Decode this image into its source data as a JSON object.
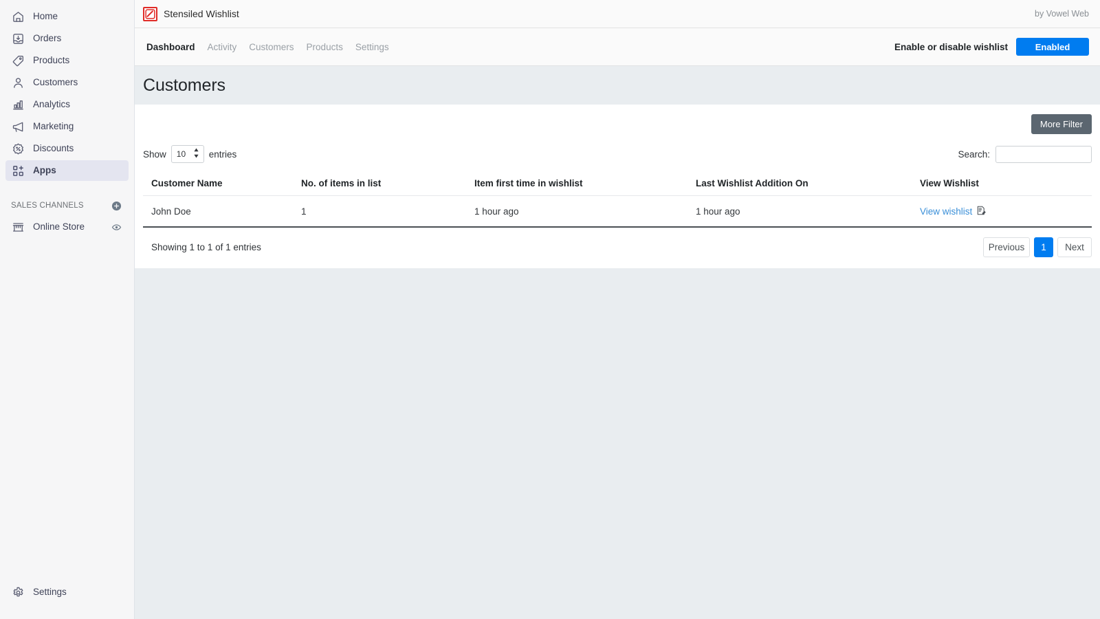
{
  "sidebar": {
    "items": [
      {
        "label": "Home",
        "icon": "home-icon",
        "active": false
      },
      {
        "label": "Orders",
        "icon": "orders-icon",
        "active": false
      },
      {
        "label": "Products",
        "icon": "products-tag-icon",
        "active": false
      },
      {
        "label": "Customers",
        "icon": "customers-person-icon",
        "active": false
      },
      {
        "label": "Analytics",
        "icon": "analytics-bars-icon",
        "active": false
      },
      {
        "label": "Marketing",
        "icon": "marketing-megaphone-icon",
        "active": false
      },
      {
        "label": "Discounts",
        "icon": "discounts-percent-icon",
        "active": false
      },
      {
        "label": "Apps",
        "icon": "apps-grid-plus-icon",
        "active": true
      }
    ],
    "section_title": "SALES CHANNELS",
    "add_channel_icon": "plus-circle-icon",
    "channels": [
      {
        "label": "Online Store",
        "icon": "storefront-icon",
        "trailing_icon": "eye-icon"
      }
    ],
    "settings": {
      "label": "Settings",
      "icon": "gear-icon"
    }
  },
  "appbar": {
    "logo_icon": "stensiled-logo-icon",
    "logo_color": "#e02b27",
    "title": "Stensiled Wishlist",
    "byline": "by Vowel Web"
  },
  "tabbar": {
    "tabs": [
      {
        "label": "Dashboard",
        "active": true
      },
      {
        "label": "Activity",
        "active": false
      },
      {
        "label": "Customers",
        "active": false
      },
      {
        "label": "Products",
        "active": false
      },
      {
        "label": "Settings",
        "active": false
      }
    ],
    "toggle_label": "Enable or disable wishlist",
    "toggle_button": "Enabled",
    "toggle_color": "#007cf0"
  },
  "page": {
    "title": "Customers"
  },
  "toolbar": {
    "more_filter": "More Filter"
  },
  "controls": {
    "show_prefix": "Show",
    "show_value": "10",
    "show_suffix": "entries",
    "search_label": "Search:",
    "search_value": "",
    "search_placeholder": ""
  },
  "table": {
    "columns": [
      "Customer Name",
      "No. of items in list",
      "Item first time in wishlist",
      "Last Wishlist Addition On",
      "View Wishlist"
    ],
    "rows": [
      {
        "customer_name": "John Doe",
        "items_count": "1",
        "first_time": "1 hour ago",
        "last_addition": "1 hour ago",
        "view_link": "View wishlist",
        "view_icon": "document-edit-icon"
      }
    ]
  },
  "footer": {
    "showing": "Showing 1 to 1 of 1 entries",
    "previous": "Previous",
    "page_number": "1",
    "next": "Next"
  }
}
